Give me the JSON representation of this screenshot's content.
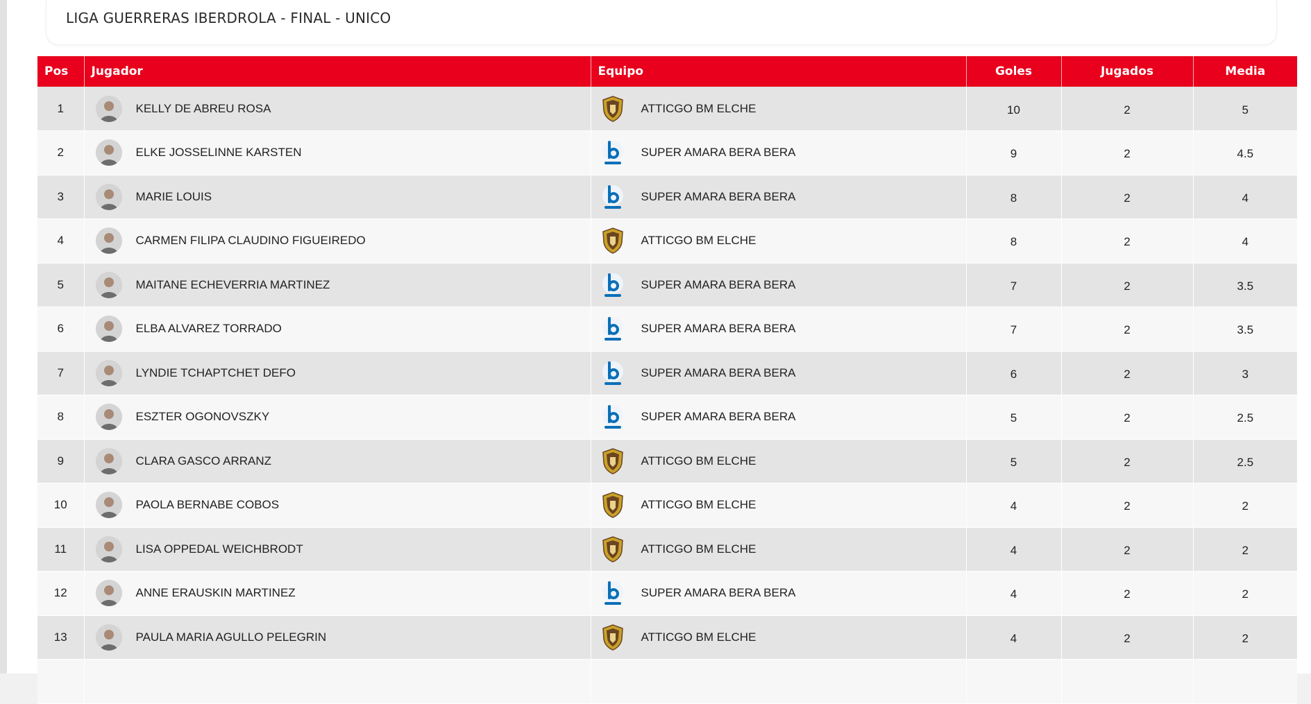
{
  "title": "LIGA GUERRERAS IBERDROLA - FINAL - UNICO",
  "colors": {
    "header_bg": "#e8001c",
    "row_odd": "#e4e4e4",
    "row_even": "#f7f7f7",
    "elche_gold": "#c9a227",
    "elche_brown": "#6b4423",
    "bera_blue": "#0a6fb8"
  },
  "columns": {
    "pos": "Pos",
    "player": "Jugador",
    "team": "Equipo",
    "goals": "Goles",
    "played": "Jugados",
    "average": "Media"
  },
  "rows": [
    {
      "pos": "1",
      "player": "KELLY DE ABREU ROSA",
      "team": "ATTICGO BM ELCHE",
      "team_logo": "elche-crest-icon",
      "goals": "10",
      "played": "2",
      "average": "5"
    },
    {
      "pos": "2",
      "player": "ELKE JOSSELINNE KARSTEN",
      "team": "SUPER AMARA BERA BERA",
      "team_logo": "bera-bera-logo-icon",
      "goals": "9",
      "played": "2",
      "average": "4.5"
    },
    {
      "pos": "3",
      "player": "MARIE LOUIS",
      "team": "SUPER AMARA BERA BERA",
      "team_logo": "bera-bera-logo-icon",
      "goals": "8",
      "played": "2",
      "average": "4"
    },
    {
      "pos": "4",
      "player": "CARMEN FILIPA CLAUDINO FIGUEIREDO",
      "team": "ATTICGO BM ELCHE",
      "team_logo": "elche-crest-icon",
      "goals": "8",
      "played": "2",
      "average": "4"
    },
    {
      "pos": "5",
      "player": "MAITANE ECHEVERRIA MARTINEZ",
      "team": "SUPER AMARA BERA BERA",
      "team_logo": "bera-bera-logo-icon",
      "goals": "7",
      "played": "2",
      "average": "3.5"
    },
    {
      "pos": "6",
      "player": "ELBA ALVAREZ TORRADO",
      "team": "SUPER AMARA BERA BERA",
      "team_logo": "bera-bera-logo-icon",
      "goals": "7",
      "played": "2",
      "average": "3.5"
    },
    {
      "pos": "7",
      "player": "LYNDIE TCHAPTCHET DEFO",
      "team": "SUPER AMARA BERA BERA",
      "team_logo": "bera-bera-logo-icon",
      "goals": "6",
      "played": "2",
      "average": "3"
    },
    {
      "pos": "8",
      "player": "ESZTER OGONOVSZKY",
      "team": "SUPER AMARA BERA BERA",
      "team_logo": "bera-bera-logo-icon",
      "goals": "5",
      "played": "2",
      "average": "2.5"
    },
    {
      "pos": "9",
      "player": "CLARA GASCO ARRANZ",
      "team": "ATTICGO BM ELCHE",
      "team_logo": "elche-crest-icon",
      "goals": "5",
      "played": "2",
      "average": "2.5"
    },
    {
      "pos": "10",
      "player": "PAOLA BERNABE COBOS",
      "team": "ATTICGO BM ELCHE",
      "team_logo": "elche-crest-icon",
      "goals": "4",
      "played": "2",
      "average": "2"
    },
    {
      "pos": "11",
      "player": "LISA OPPEDAL WEICHBRODT",
      "team": "ATTICGO BM ELCHE",
      "team_logo": "elche-crest-icon",
      "goals": "4",
      "played": "2",
      "average": "2"
    },
    {
      "pos": "12",
      "player": "ANNE ERAUSKIN MARTINEZ",
      "team": "SUPER AMARA BERA BERA",
      "team_logo": "bera-bera-logo-icon",
      "goals": "4",
      "played": "2",
      "average": "2"
    },
    {
      "pos": "13",
      "player": "PAULA MARIA AGULLO PELEGRIN",
      "team": "ATTICGO BM ELCHE",
      "team_logo": "elche-crest-icon",
      "goals": "4",
      "played": "2",
      "average": "2"
    }
  ]
}
